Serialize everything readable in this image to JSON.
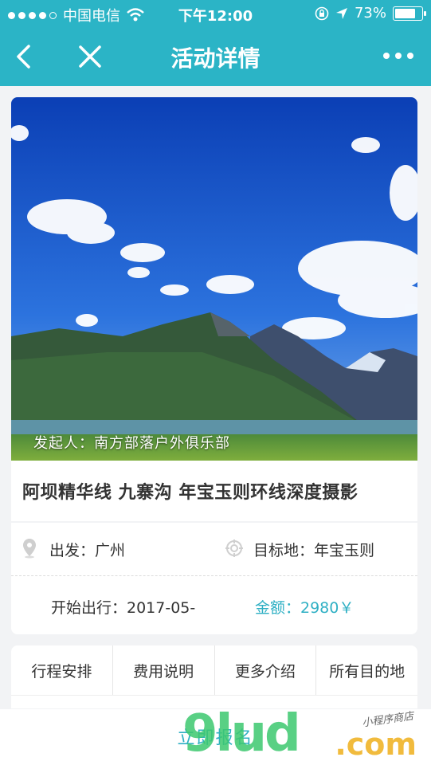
{
  "status_bar": {
    "carrier": "中国电信",
    "time": "下午12:00",
    "battery": "73%",
    "battery_level": 0.73
  },
  "nav": {
    "title": "活动详情",
    "back_icon": "chevron-left-icon",
    "close_icon": "close-icon",
    "more_icon": "more-dots-icon"
  },
  "hero": {
    "organizer": "发起人：南方部落户外俱乐部"
  },
  "activity": {
    "title": "阿坝精华线 九寨沟 年宝玉则环线深度摄影"
  },
  "info": {
    "from": "出发：广州",
    "destination": "目标地：年宝玉则",
    "start": "开始出行：2017-05-",
    "amount": "金额：2980￥"
  },
  "tabs": [
    "行程安排",
    "费用说明",
    "更多介绍",
    "所有目的地"
  ],
  "bottom": {
    "signup_label": "立即报名"
  },
  "watermark": {
    "big": "9lud",
    "com": ".com",
    "small": "小程序商店"
  },
  "colors": {
    "accent": "#2bb4c6",
    "amount": "#2fb0c4"
  }
}
